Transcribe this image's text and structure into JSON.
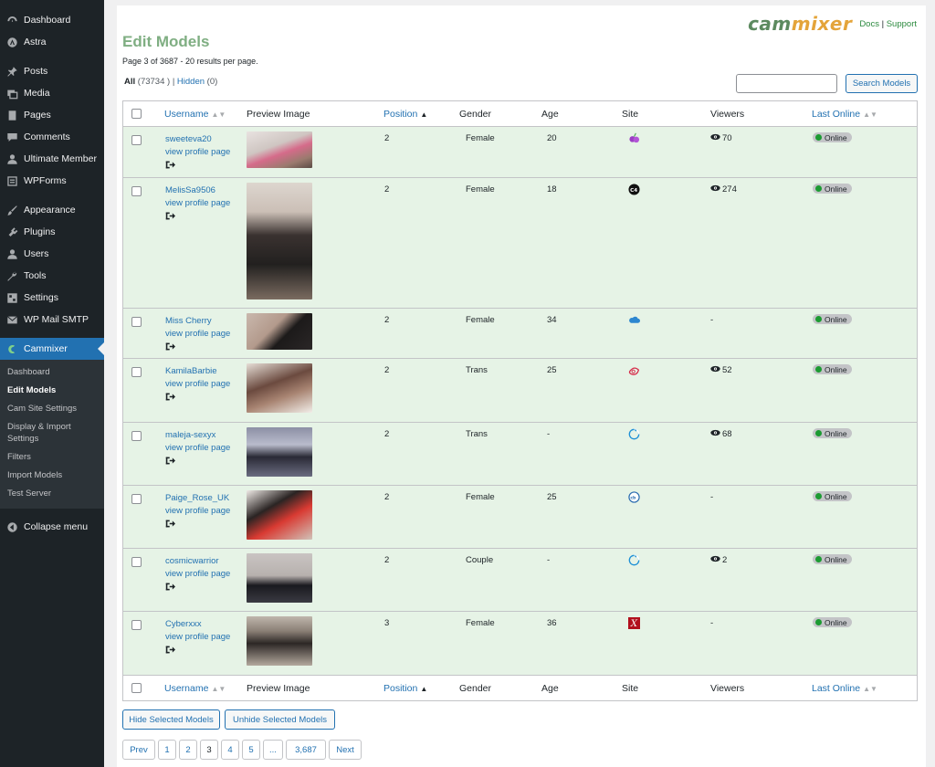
{
  "sidebar": {
    "items": [
      {
        "label": "Dashboard",
        "icon": "dashboard-icon"
      },
      {
        "label": "Astra",
        "icon": "astra-icon"
      },
      {
        "label": "Posts",
        "icon": "pin-icon"
      },
      {
        "label": "Media",
        "icon": "media-icon"
      },
      {
        "label": "Pages",
        "icon": "pages-icon"
      },
      {
        "label": "Comments",
        "icon": "comments-icon"
      },
      {
        "label": "Ultimate Member",
        "icon": "user-icon"
      },
      {
        "label": "WPForms",
        "icon": "forms-icon"
      },
      {
        "label": "Appearance",
        "icon": "paintbrush-icon"
      },
      {
        "label": "Plugins",
        "icon": "plugin-icon"
      },
      {
        "label": "Users",
        "icon": "users-icon"
      },
      {
        "label": "Tools",
        "icon": "wrench-icon"
      },
      {
        "label": "Settings",
        "icon": "settings-icon"
      },
      {
        "label": "WP Mail SMTP",
        "icon": "mail-icon"
      },
      {
        "label": "Cammixer",
        "icon": "cammixer-icon"
      }
    ],
    "submenu": [
      "Dashboard",
      "Edit Models",
      "Cam Site Settings",
      "Display & Import Settings",
      "Filters",
      "Import Models",
      "Test Server"
    ],
    "collapse": "Collapse menu"
  },
  "brand": {
    "logo_a": "cam",
    "logo_b": "mixer",
    "docs": "Docs",
    "sep": "|",
    "support": "Support"
  },
  "page": {
    "title": "Edit Models",
    "info": "Page 3 of 3687 - 20 results per page.",
    "filter_all": "All",
    "filter_all_count": "(73734 )",
    "filter_sep": "|",
    "filter_hidden": "Hidden",
    "filter_hidden_count": "(0)",
    "search_button": "Search Models"
  },
  "columns": {
    "username": "Username",
    "preview": "Preview Image",
    "position": "Position",
    "gender": "Gender",
    "age": "Age",
    "site": "Site",
    "viewers": "Viewers",
    "last_online": "Last Online"
  },
  "rows": [
    {
      "username": "sweeteva20",
      "profile": "view profile page",
      "position": "2",
      "gender": "Female",
      "age": "20",
      "site_icon": "cherry-icon",
      "viewers": "70",
      "status": "Online"
    },
    {
      "username": "MelisSa9506",
      "profile": "view profile page",
      "position": "2",
      "gender": "Female",
      "age": "18",
      "site_icon": "cam4-icon",
      "viewers": "274",
      "status": "Online"
    },
    {
      "username": "Miss Cherry",
      "profile": "view profile page",
      "position": "2",
      "gender": "Female",
      "age": "34",
      "site_icon": "cloud-icon",
      "viewers": "-",
      "status": "Online"
    },
    {
      "username": "KamilaBarbie",
      "profile": "view profile page",
      "position": "2",
      "gender": "Trans",
      "age": "25",
      "site_icon": "lips-icon",
      "viewers": "52",
      "status": "Online"
    },
    {
      "username": "maleja-sexyx",
      "profile": "view profile page",
      "position": "2",
      "gender": "Trans",
      "age": "-",
      "site_icon": "circle-arrow-icon",
      "viewers": "68",
      "status": "Online"
    },
    {
      "username": "Paige_Rose_UK",
      "profile": "view profile page",
      "position": "2",
      "gender": "Female",
      "age": "25",
      "site_icon": "chat-logo-icon",
      "viewers": "-",
      "status": "Online"
    },
    {
      "username": "cosmicwarrior",
      "profile": "view profile page",
      "position": "2",
      "gender": "Couple",
      "age": "-",
      "site_icon": "circle-arrow-icon",
      "viewers": "2",
      "status": "Online"
    },
    {
      "username": "Cyberxxx",
      "profile": "view profile page",
      "position": "3",
      "gender": "Female",
      "age": "36",
      "site_icon": "x-logo-icon",
      "viewers": "-",
      "status": "Online"
    }
  ],
  "bulk": {
    "hide": "Hide Selected Models",
    "unhide": "Unhide Selected Models"
  },
  "pagination": {
    "prev": "Prev",
    "pages": [
      "1",
      "2",
      "3",
      "4",
      "5",
      "...",
      "3,687"
    ],
    "current": "3",
    "next": "Next"
  }
}
